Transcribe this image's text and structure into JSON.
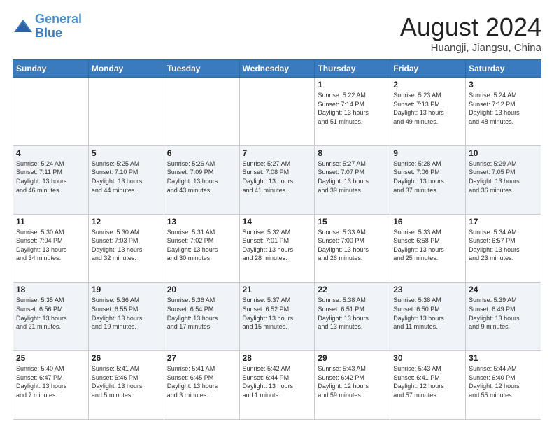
{
  "header": {
    "logo_line1": "General",
    "logo_line2": "Blue",
    "month_title": "August 2024",
    "location": "Huangji, Jiangsu, China"
  },
  "weekdays": [
    "Sunday",
    "Monday",
    "Tuesday",
    "Wednesday",
    "Thursday",
    "Friday",
    "Saturday"
  ],
  "weeks": [
    [
      {
        "day": "",
        "info": ""
      },
      {
        "day": "",
        "info": ""
      },
      {
        "day": "",
        "info": ""
      },
      {
        "day": "",
        "info": ""
      },
      {
        "day": "1",
        "info": "Sunrise: 5:22 AM\nSunset: 7:14 PM\nDaylight: 13 hours\nand 51 minutes."
      },
      {
        "day": "2",
        "info": "Sunrise: 5:23 AM\nSunset: 7:13 PM\nDaylight: 13 hours\nand 49 minutes."
      },
      {
        "day": "3",
        "info": "Sunrise: 5:24 AM\nSunset: 7:12 PM\nDaylight: 13 hours\nand 48 minutes."
      }
    ],
    [
      {
        "day": "4",
        "info": "Sunrise: 5:24 AM\nSunset: 7:11 PM\nDaylight: 13 hours\nand 46 minutes."
      },
      {
        "day": "5",
        "info": "Sunrise: 5:25 AM\nSunset: 7:10 PM\nDaylight: 13 hours\nand 44 minutes."
      },
      {
        "day": "6",
        "info": "Sunrise: 5:26 AM\nSunset: 7:09 PM\nDaylight: 13 hours\nand 43 minutes."
      },
      {
        "day": "7",
        "info": "Sunrise: 5:27 AM\nSunset: 7:08 PM\nDaylight: 13 hours\nand 41 minutes."
      },
      {
        "day": "8",
        "info": "Sunrise: 5:27 AM\nSunset: 7:07 PM\nDaylight: 13 hours\nand 39 minutes."
      },
      {
        "day": "9",
        "info": "Sunrise: 5:28 AM\nSunset: 7:06 PM\nDaylight: 13 hours\nand 37 minutes."
      },
      {
        "day": "10",
        "info": "Sunrise: 5:29 AM\nSunset: 7:05 PM\nDaylight: 13 hours\nand 36 minutes."
      }
    ],
    [
      {
        "day": "11",
        "info": "Sunrise: 5:30 AM\nSunset: 7:04 PM\nDaylight: 13 hours\nand 34 minutes."
      },
      {
        "day": "12",
        "info": "Sunrise: 5:30 AM\nSunset: 7:03 PM\nDaylight: 13 hours\nand 32 minutes."
      },
      {
        "day": "13",
        "info": "Sunrise: 5:31 AM\nSunset: 7:02 PM\nDaylight: 13 hours\nand 30 minutes."
      },
      {
        "day": "14",
        "info": "Sunrise: 5:32 AM\nSunset: 7:01 PM\nDaylight: 13 hours\nand 28 minutes."
      },
      {
        "day": "15",
        "info": "Sunrise: 5:33 AM\nSunset: 7:00 PM\nDaylight: 13 hours\nand 26 minutes."
      },
      {
        "day": "16",
        "info": "Sunrise: 5:33 AM\nSunset: 6:58 PM\nDaylight: 13 hours\nand 25 minutes."
      },
      {
        "day": "17",
        "info": "Sunrise: 5:34 AM\nSunset: 6:57 PM\nDaylight: 13 hours\nand 23 minutes."
      }
    ],
    [
      {
        "day": "18",
        "info": "Sunrise: 5:35 AM\nSunset: 6:56 PM\nDaylight: 13 hours\nand 21 minutes."
      },
      {
        "day": "19",
        "info": "Sunrise: 5:36 AM\nSunset: 6:55 PM\nDaylight: 13 hours\nand 19 minutes."
      },
      {
        "day": "20",
        "info": "Sunrise: 5:36 AM\nSunset: 6:54 PM\nDaylight: 13 hours\nand 17 minutes."
      },
      {
        "day": "21",
        "info": "Sunrise: 5:37 AM\nSunset: 6:52 PM\nDaylight: 13 hours\nand 15 minutes."
      },
      {
        "day": "22",
        "info": "Sunrise: 5:38 AM\nSunset: 6:51 PM\nDaylight: 13 hours\nand 13 minutes."
      },
      {
        "day": "23",
        "info": "Sunrise: 5:38 AM\nSunset: 6:50 PM\nDaylight: 13 hours\nand 11 minutes."
      },
      {
        "day": "24",
        "info": "Sunrise: 5:39 AM\nSunset: 6:49 PM\nDaylight: 13 hours\nand 9 minutes."
      }
    ],
    [
      {
        "day": "25",
        "info": "Sunrise: 5:40 AM\nSunset: 6:47 PM\nDaylight: 13 hours\nand 7 minutes."
      },
      {
        "day": "26",
        "info": "Sunrise: 5:41 AM\nSunset: 6:46 PM\nDaylight: 13 hours\nand 5 minutes."
      },
      {
        "day": "27",
        "info": "Sunrise: 5:41 AM\nSunset: 6:45 PM\nDaylight: 13 hours\nand 3 minutes."
      },
      {
        "day": "28",
        "info": "Sunrise: 5:42 AM\nSunset: 6:44 PM\nDaylight: 13 hours\nand 1 minute."
      },
      {
        "day": "29",
        "info": "Sunrise: 5:43 AM\nSunset: 6:42 PM\nDaylight: 12 hours\nand 59 minutes."
      },
      {
        "day": "30",
        "info": "Sunrise: 5:43 AM\nSunset: 6:41 PM\nDaylight: 12 hours\nand 57 minutes."
      },
      {
        "day": "31",
        "info": "Sunrise: 5:44 AM\nSunset: 6:40 PM\nDaylight: 12 hours\nand 55 minutes."
      }
    ]
  ]
}
